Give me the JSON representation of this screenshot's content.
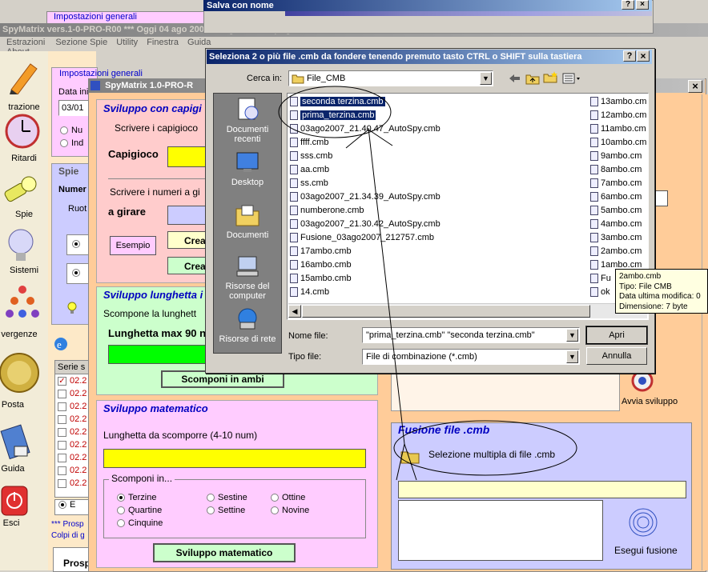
{
  "back_window": {
    "title": "SpyMatrix vers.1-0-PRO-R00  ***  Oggi 04 ago 2007  ***   - [Sezione Spie]",
    "menu": [
      "Estrazioni",
      "Sezione Spie",
      "Utility",
      "Finestra",
      "Guida",
      "About"
    ],
    "top_title": "Impostazioni generali",
    "top_title2": "Impostazioni generali"
  },
  "sidebar": [
    {
      "label": "trazione",
      "icon": "pencil-icon"
    },
    {
      "label": "Ritardi",
      "icon": "clock-icon"
    },
    {
      "label": "Spie",
      "icon": "flashlight-icon"
    },
    {
      "label": "Sistemi",
      "icon": "lightbulb-icon"
    },
    {
      "label": "vergenze",
      "icon": "convergence-icon"
    },
    {
      "label": "Posta",
      "icon": "coin-icon"
    },
    {
      "label": "Guida",
      "icon": "book-icon"
    },
    {
      "label": "Esci",
      "icon": "exit-icon"
    }
  ],
  "left_panel": {
    "data_ini_label": "Data ini",
    "data_ini_value": "03/01",
    "radio_nu": "Nu",
    "radio_ind": "Ind",
    "spie_title": "Spie",
    "numer_label": "Numer",
    "ruot_label": "Ruot",
    "serie_label": "Serie s",
    "rows": [
      "02.2",
      "02.2",
      "02.2",
      "02.2",
      "02.2",
      "02.2",
      "02.2",
      "02.2",
      "02.2"
    ],
    "e_label": "E",
    "prosp_note": "*** Prosp",
    "colpi_note": "Colpi di g",
    "prosp_btn": "Prosp"
  },
  "spy_window": {
    "title": "SpyMatrix 1.0-PRO-R",
    "capigioco_section": {
      "title": "Sviluppo con capigi",
      "instr1": "Scrivere i capigioco",
      "capigioco_label": "Capigioco",
      "instr2": "Scrivere i numeri a gi",
      "agirare_label": "a girare",
      "esempio_btn": "Esempio",
      "crea1": "Crea",
      "crea2": "Crea"
    },
    "lunghetta_section": {
      "title": "Sviluppo lunghetta i",
      "desc": "Scompone la lunghett",
      "max_label": "Lunghetta max 90 n",
      "scomponi_btn": "Scomponi in ambi"
    },
    "matematico_section": {
      "title": "Sviluppo matematico",
      "length_label": "Lunghetta da scomporre (4-10 num)",
      "group_title": "Scomponi in...",
      "options": [
        "Terzine",
        "Sestine",
        "Ottine",
        "Quartine",
        "Settine",
        "Novine",
        "Cinquine"
      ],
      "selected": "Terzine",
      "btn": "Sviluppo matematico"
    },
    "avvia_label": "Avvia sviluppo",
    "fusione": {
      "title": "Fusione file .cmb",
      "selezione_label": "Selezione multipla di file .cmb",
      "esegui_label": "Esegui fusione"
    }
  },
  "save_dialog": {
    "title": "Salva con nome"
  },
  "open_dialog": {
    "title": "Seleziona 2 o più file .cmb da fondere tenendo premuto tasto CTRL o SHIFT sulla tastiera",
    "cerca_in_label": "Cerca in:",
    "folder": "File_CMB",
    "places": [
      {
        "label": "Documenti recenti",
        "icon": "recent-docs-icon"
      },
      {
        "label": "Desktop",
        "icon": "desktop-icon"
      },
      {
        "label": "Documenti",
        "icon": "documents-icon"
      },
      {
        "label": "Risorse del computer",
        "icon": "computer-icon"
      },
      {
        "label": "Risorse di rete",
        "icon": "network-icon"
      }
    ],
    "files_col1": [
      "seconda terzina.cmb",
      "prima_terzina.cmb",
      "03ago2007_21.40.47_AutoSpy.cmb",
      "ffff.cmb",
      "sss.cmb",
      "aa.cmb",
      "ss.cmb",
      "03ago2007_21.34.39_AutoSpy.cmb",
      "numberone.cmb",
      "03ago2007_21.30.42_AutoSpy.cmb",
      "Fusione_03ago2007_212757.cmb",
      "17ambo.cmb",
      "16ambo.cmb",
      "15ambo.cmb",
      "14.cmb"
    ],
    "selected_files": [
      "seconda terzina.cmb",
      "prima_terzina.cmb"
    ],
    "files_col2": [
      "13ambo.cm",
      "12ambo.cm",
      "11ambo.cm",
      "10ambo.cm",
      "9ambo.cm",
      "8ambo.cm",
      "7ambo.cm",
      "6ambo.cm",
      "5ambo.cm",
      "4ambo.cm",
      "3ambo.cm",
      "2ambo.cm",
      "1ambo.cm",
      "Fu",
      "ok"
    ],
    "nome_file_label": "Nome file:",
    "nome_file_value": "\"prima_terzina.cmb\" \"seconda terzina.cmb\"",
    "tipo_file_label": "Tipo file:",
    "tipo_file_value": "File di combinazione (*.cmb)",
    "apri_btn": "Apri",
    "annulla_btn": "Annulla"
  },
  "tooltip": {
    "name": "2ambo.cmb",
    "tipo": "Tipo: File CMB",
    "data": "Data ultima modifica: 0",
    "dim": "Dimensione: 7 byte"
  },
  "colors": {
    "title_active": "#0a246a",
    "title_inactive": "#808080",
    "pink": "#ffccff",
    "salmon": "#ffcccc",
    "mint": "#ccffcc",
    "lavender": "#ccccff",
    "peach": "#ffcc99",
    "yellow": "#ffff00",
    "green": "#00ff00"
  }
}
